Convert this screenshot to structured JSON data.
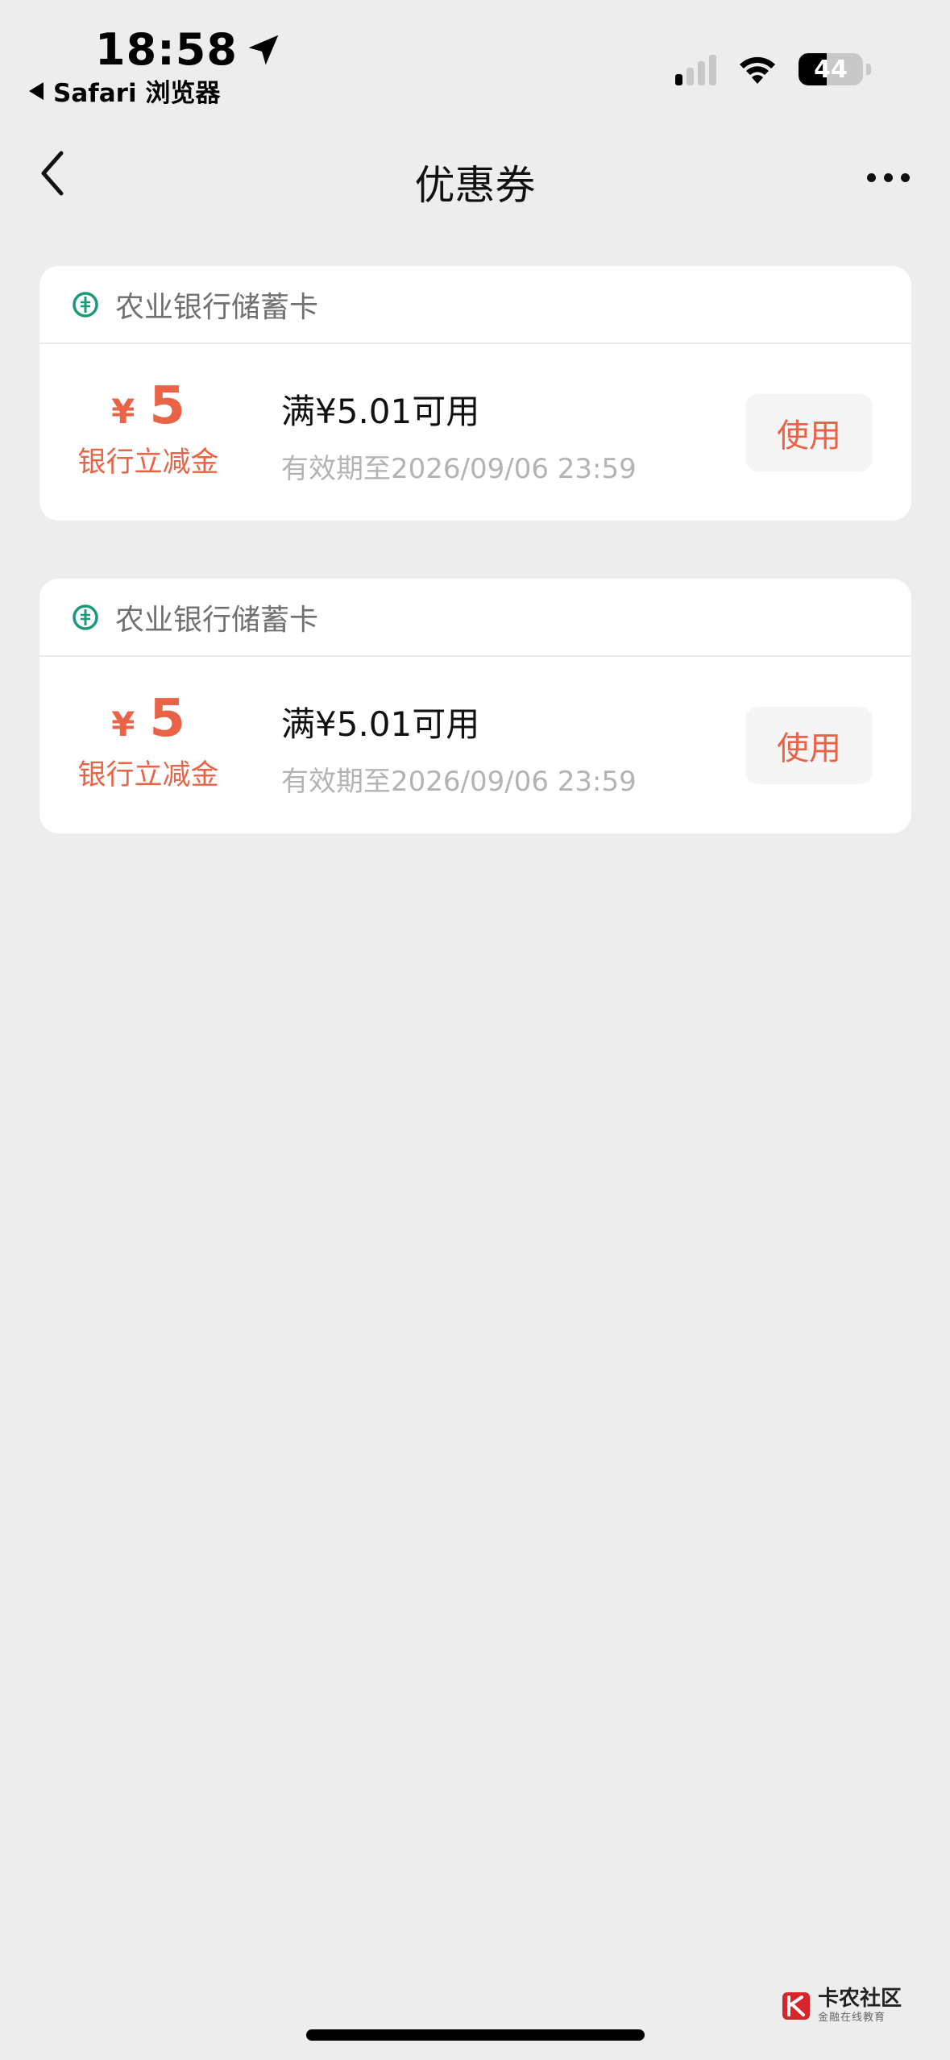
{
  "status_bar": {
    "time": "18:58",
    "back_app": "Safari 浏览器",
    "battery_percent": "44",
    "battery_level": 0.44,
    "signal_bars_active": 1,
    "signal_bars_total": 4
  },
  "nav": {
    "title": "优惠券"
  },
  "coupons": [
    {
      "bank": "农业银行储蓄卡",
      "currency_symbol": "¥",
      "amount": "5",
      "type_label": "银行立减金",
      "condition": "满¥5.01可用",
      "validity": "有效期至2026/09/06 23:59",
      "action_label": "使用"
    },
    {
      "bank": "农业银行储蓄卡",
      "currency_symbol": "¥",
      "amount": "5",
      "type_label": "银行立减金",
      "condition": "满¥5.01可用",
      "validity": "有效期至2026/09/06 23:59",
      "action_label": "使用"
    }
  ],
  "watermark": {
    "main": "卡农社区",
    "sub": "金融在线教育"
  },
  "colors": {
    "accent": "#ea6346",
    "bank_green": "#1a9a7a",
    "background": "#ededed"
  }
}
